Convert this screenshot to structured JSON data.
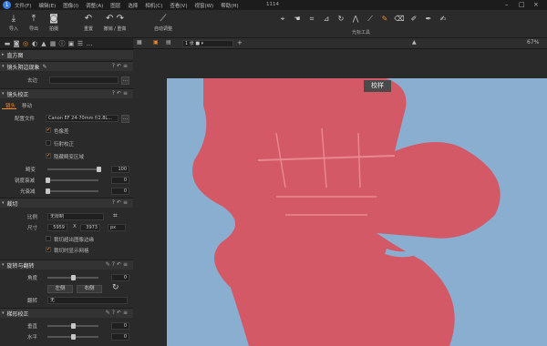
{
  "menubar": {
    "items": [
      "文件(F)",
      "编辑(E)",
      "图像(I)",
      "调整(A)",
      "图层",
      "选择",
      "相机(C)",
      "查看(V)",
      "视窗(W)",
      "帮助(H)"
    ],
    "window_title": "1114"
  },
  "toolbar": {
    "import": "导入",
    "export": "导出",
    "capture": "拍摄",
    "reset": "重置",
    "undo_redo": "撤销 / 重做",
    "auto_adjust": "自动调整",
    "cursor_tools_label": "光标工具"
  },
  "viewbar": {
    "layout_select": "1 张 ■ ▾",
    "zoom": "67%"
  },
  "left": {
    "histogram_title": "直方图",
    "vignette_title": "镜头阴边现象",
    "vignette_remove_label": "去边",
    "lens_title": "镜头校正",
    "lens_tab": "镜头",
    "move_tab": "移动",
    "profile_label": "配置文件",
    "profile_value": "Canon EF 24-70mm f/2.8L...",
    "chromatic_label": "色像差",
    "diffraction_label": "衍射校正",
    "hide_distorted_label": "隐藏畸变区域",
    "distortion_label": "畸变",
    "distortion_value": "100",
    "distortion_level": 1.0,
    "sharpness_label": "锐度衰减",
    "sharpness_value": "0",
    "sharpness_level": 0.0,
    "light_label": "光衰减",
    "light_value": "0",
    "light_level": 0.0,
    "crop_title": "裁切",
    "ratio_label": "比例",
    "ratio_value": "无限制",
    "size_label": "尺寸",
    "size_w": "5959",
    "size_x": "X",
    "size_h": "3973",
    "size_unit": "px",
    "crop_outside_label": "裁切超出图像边缘",
    "crop_grid_label": "裁切时显示网格",
    "rotate_title": "旋转与翻转",
    "angle_label": "角度",
    "angle_value": "0",
    "angle_level": 0.5,
    "left_btn": "左侧",
    "right_btn": "右侧",
    "flip_label": "翻转",
    "flip_value": "无",
    "keystone_title": "梯形校正",
    "vertical_label": "垂直",
    "vertical_value": "0",
    "vertical_level": 0.5,
    "horizontal_label": "水平",
    "horizontal_value": "0",
    "horizontal_level": 0.5
  },
  "viewer": {
    "preview_label": "校样"
  },
  "colors": {
    "accent": "#f08a2c",
    "mask": "#e04a5a",
    "sky": "#8aaed0"
  }
}
